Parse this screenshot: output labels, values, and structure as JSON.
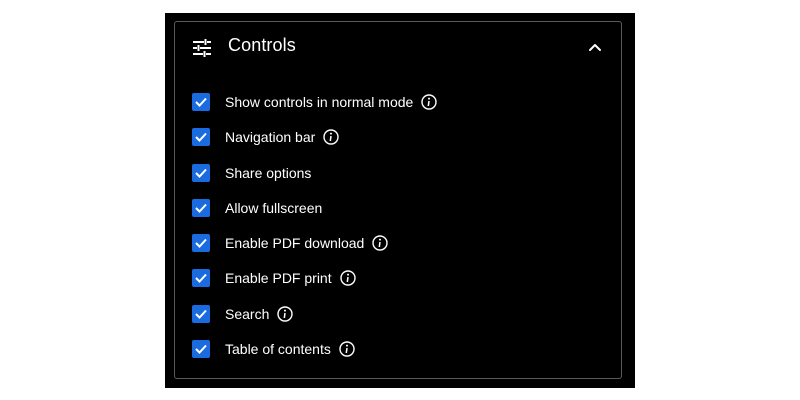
{
  "panel": {
    "title": "Controls",
    "header_icon": "sliders-icon",
    "collapse_icon": "chevron-up-icon",
    "accent_color": "#1a6be0"
  },
  "options": [
    {
      "label": "Show controls in normal mode",
      "checked": true,
      "info": true
    },
    {
      "label": "Navigation bar",
      "checked": true,
      "info": true
    },
    {
      "label": "Share options",
      "checked": true,
      "info": false
    },
    {
      "label": "Allow fullscreen",
      "checked": true,
      "info": false
    },
    {
      "label": "Enable PDF download",
      "checked": true,
      "info": true
    },
    {
      "label": "Enable PDF print",
      "checked": true,
      "info": true
    },
    {
      "label": "Search",
      "checked": true,
      "info": true
    },
    {
      "label": "Table of contents",
      "checked": true,
      "info": true
    }
  ]
}
